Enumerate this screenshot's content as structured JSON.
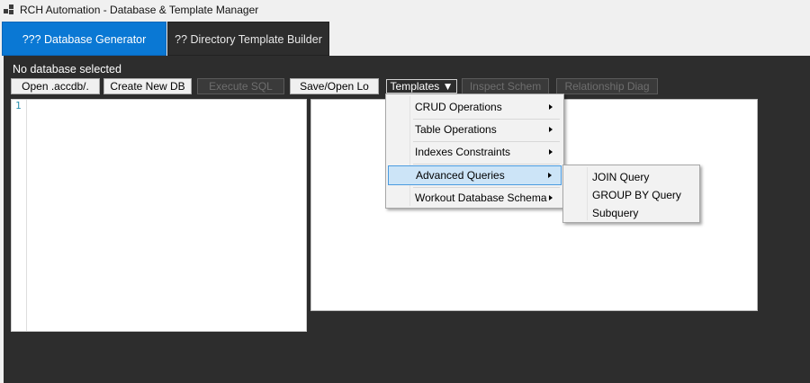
{
  "window": {
    "title": "RCH Automation - Database & Template Manager",
    "icon": "app-grid-icon"
  },
  "tabs": [
    {
      "label": "??? Database Generator",
      "active": true
    },
    {
      "label": "?? Directory Template Builder",
      "active": false
    }
  ],
  "status_text": "No database selected",
  "toolbar": {
    "open_label": "Open .accdb/.",
    "create_label": "Create New DB",
    "execute_label": "Execute SQL",
    "save_label": "Save/Open Lo",
    "templates_label": "Templates ▼",
    "inspect_label": "Inspect Schem",
    "relationship_label": "Relationship Diag"
  },
  "editor": {
    "line_number": "1"
  },
  "templates_menu": {
    "items": [
      {
        "label": "CRUD Operations",
        "has_submenu": true
      },
      {
        "label": "Table Operations",
        "has_submenu": true
      },
      {
        "label": "Indexes  Constraints",
        "has_submenu": true
      },
      {
        "label": "Advanced Queries",
        "has_submenu": true,
        "highlighted": true
      },
      {
        "label": "Workout Database Schema",
        "has_submenu": true
      }
    ]
  },
  "advanced_submenu": {
    "items": [
      {
        "label": "JOIN Query"
      },
      {
        "label": "GROUP BY Query"
      },
      {
        "label": "Subquery"
      }
    ]
  },
  "colors": {
    "accent": "#0a78d4",
    "workspace_bg": "#2d2d2d",
    "menu_highlight": "#cce4f7"
  }
}
